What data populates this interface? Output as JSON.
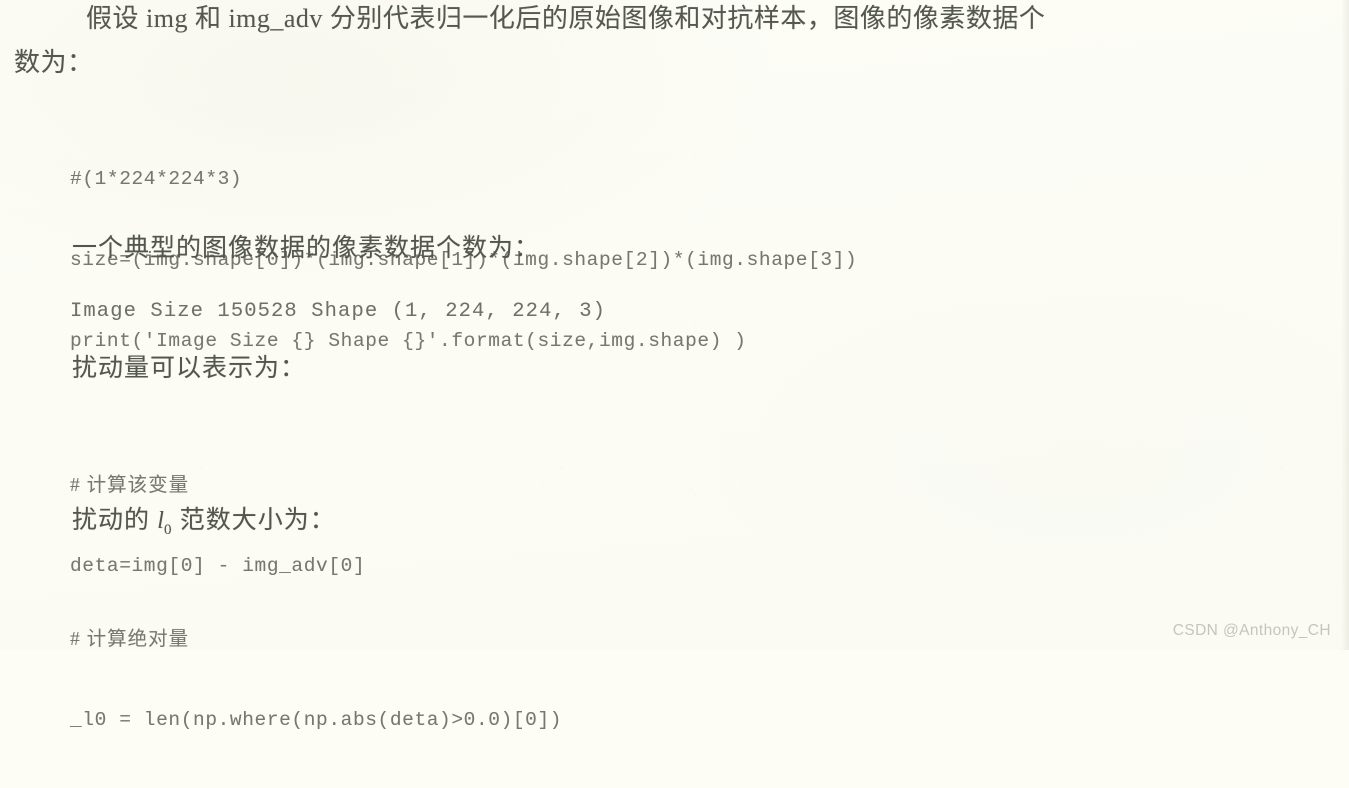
{
  "document": {
    "type": "scanned-book-page",
    "language": "zh-CN",
    "background_color": "#fdfdf6",
    "body_text_color": "#55584f",
    "code_text_color": "#75786f",
    "watermark_color": "#c3c5bf"
  },
  "paragraph": {
    "line1": "假设 img 和 img_adv 分别代表归一化后的原始图像和对抗样本，图像的像素数据个",
    "line2": "数为："
  },
  "code_block_1": {
    "line1": "#(1*224*224*3)",
    "line2": "size=(img.shape[0])*(img.shape[1])*(img.shape[2])*(img.shape[3])",
    "line3": "print('Image Size {} Shape {}'.format(size,img.shape) )"
  },
  "heading_typical": "一个典型的图像数据的像素数据个数为：",
  "code_output": "Image Size 150528 Shape (1, 224, 224, 3)",
  "heading_perturbation": "扰动量可以表示为：",
  "code_block_2": {
    "line1_comment": "# 计算该变量",
    "line2": "deta=img[0] - img_adv[0]"
  },
  "heading_l0norm": {
    "prefix": "扰动的 ",
    "symbol": "l",
    "subscript": "0",
    "suffix": " 范数大小为："
  },
  "code_block_3": {
    "line1_comment": "# 计算绝对量",
    "line2": "_l0 = len(np.where(np.abs(deta)>0.0)[0])"
  },
  "watermark": "CSDN @Anthony_CH"
}
